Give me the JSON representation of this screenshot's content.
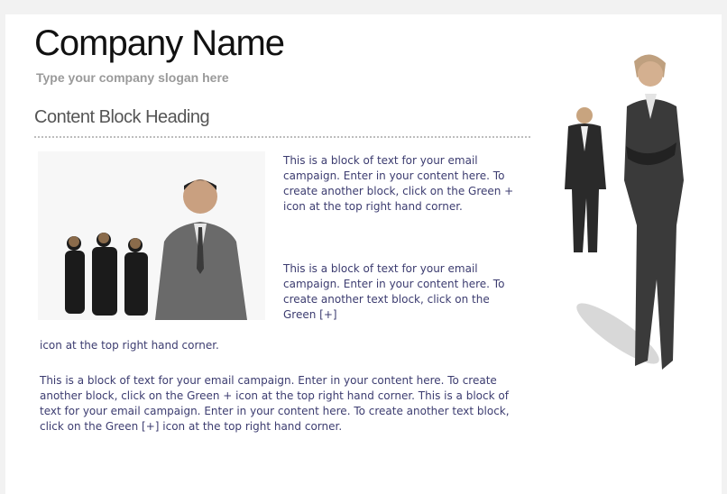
{
  "header": {
    "company_name": "Company Name",
    "slogan": "Type your company slogan here"
  },
  "content": {
    "heading": "Content Block Heading",
    "block1": "This is a block of text for your email campaign. Enter in your content here. To create another block, click on the Green + icon at the top right hand corner.",
    "block2_wrapped": "This is a block of text for your email campaign. Enter in your content here. To create another text block, click on the Green [+]",
    "block2_tail": "icon at the top right hand corner.",
    "block3": "This is a block of text for your email campaign. Enter in your content here. To create another block, click on the Green + icon at the top right hand corner. This is a block of text for your email campaign. Enter in your content here. To create another text block, click on the Green [+] icon at the top right hand corner."
  },
  "images": {
    "team_photo": "business-team-photo",
    "people_photo": "business-people-photo"
  }
}
